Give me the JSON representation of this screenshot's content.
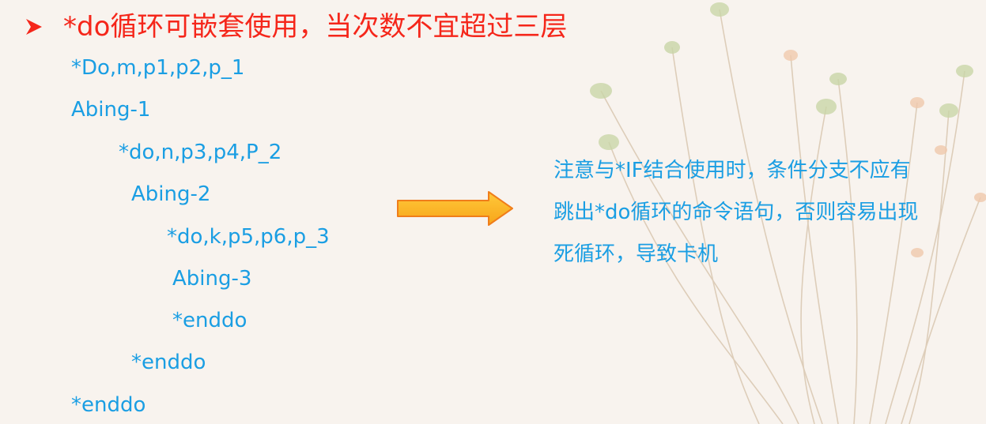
{
  "slide": {
    "heading": "*do循环可嵌套使用，当次数不宜超过三层",
    "code_lines": [
      "*Do,m,p1,p2,p_1",
      "Abing-1",
      "*do,n,p3,p4,P_2",
      "Abing-2",
      "*do,k,p5,p6,p_3",
      "Abing-3",
      "*enddo",
      "*enddo",
      "*enddo"
    ],
    "note_lines": [
      "注意与*IF结合使用时，条件分支不应有",
      "跳出*do循环的命令语句，否则容易出现",
      "死循环，导致卡机"
    ]
  },
  "colors": {
    "heading": "#f5261a",
    "code": "#1a9ee3",
    "note": "#1a9ee3",
    "arrow_fill": "#fdb813",
    "arrow_stroke": "#f07d1a"
  },
  "icons": {
    "bullet": "arrowhead-bullet-icon",
    "arrow": "right-arrow-icon"
  }
}
